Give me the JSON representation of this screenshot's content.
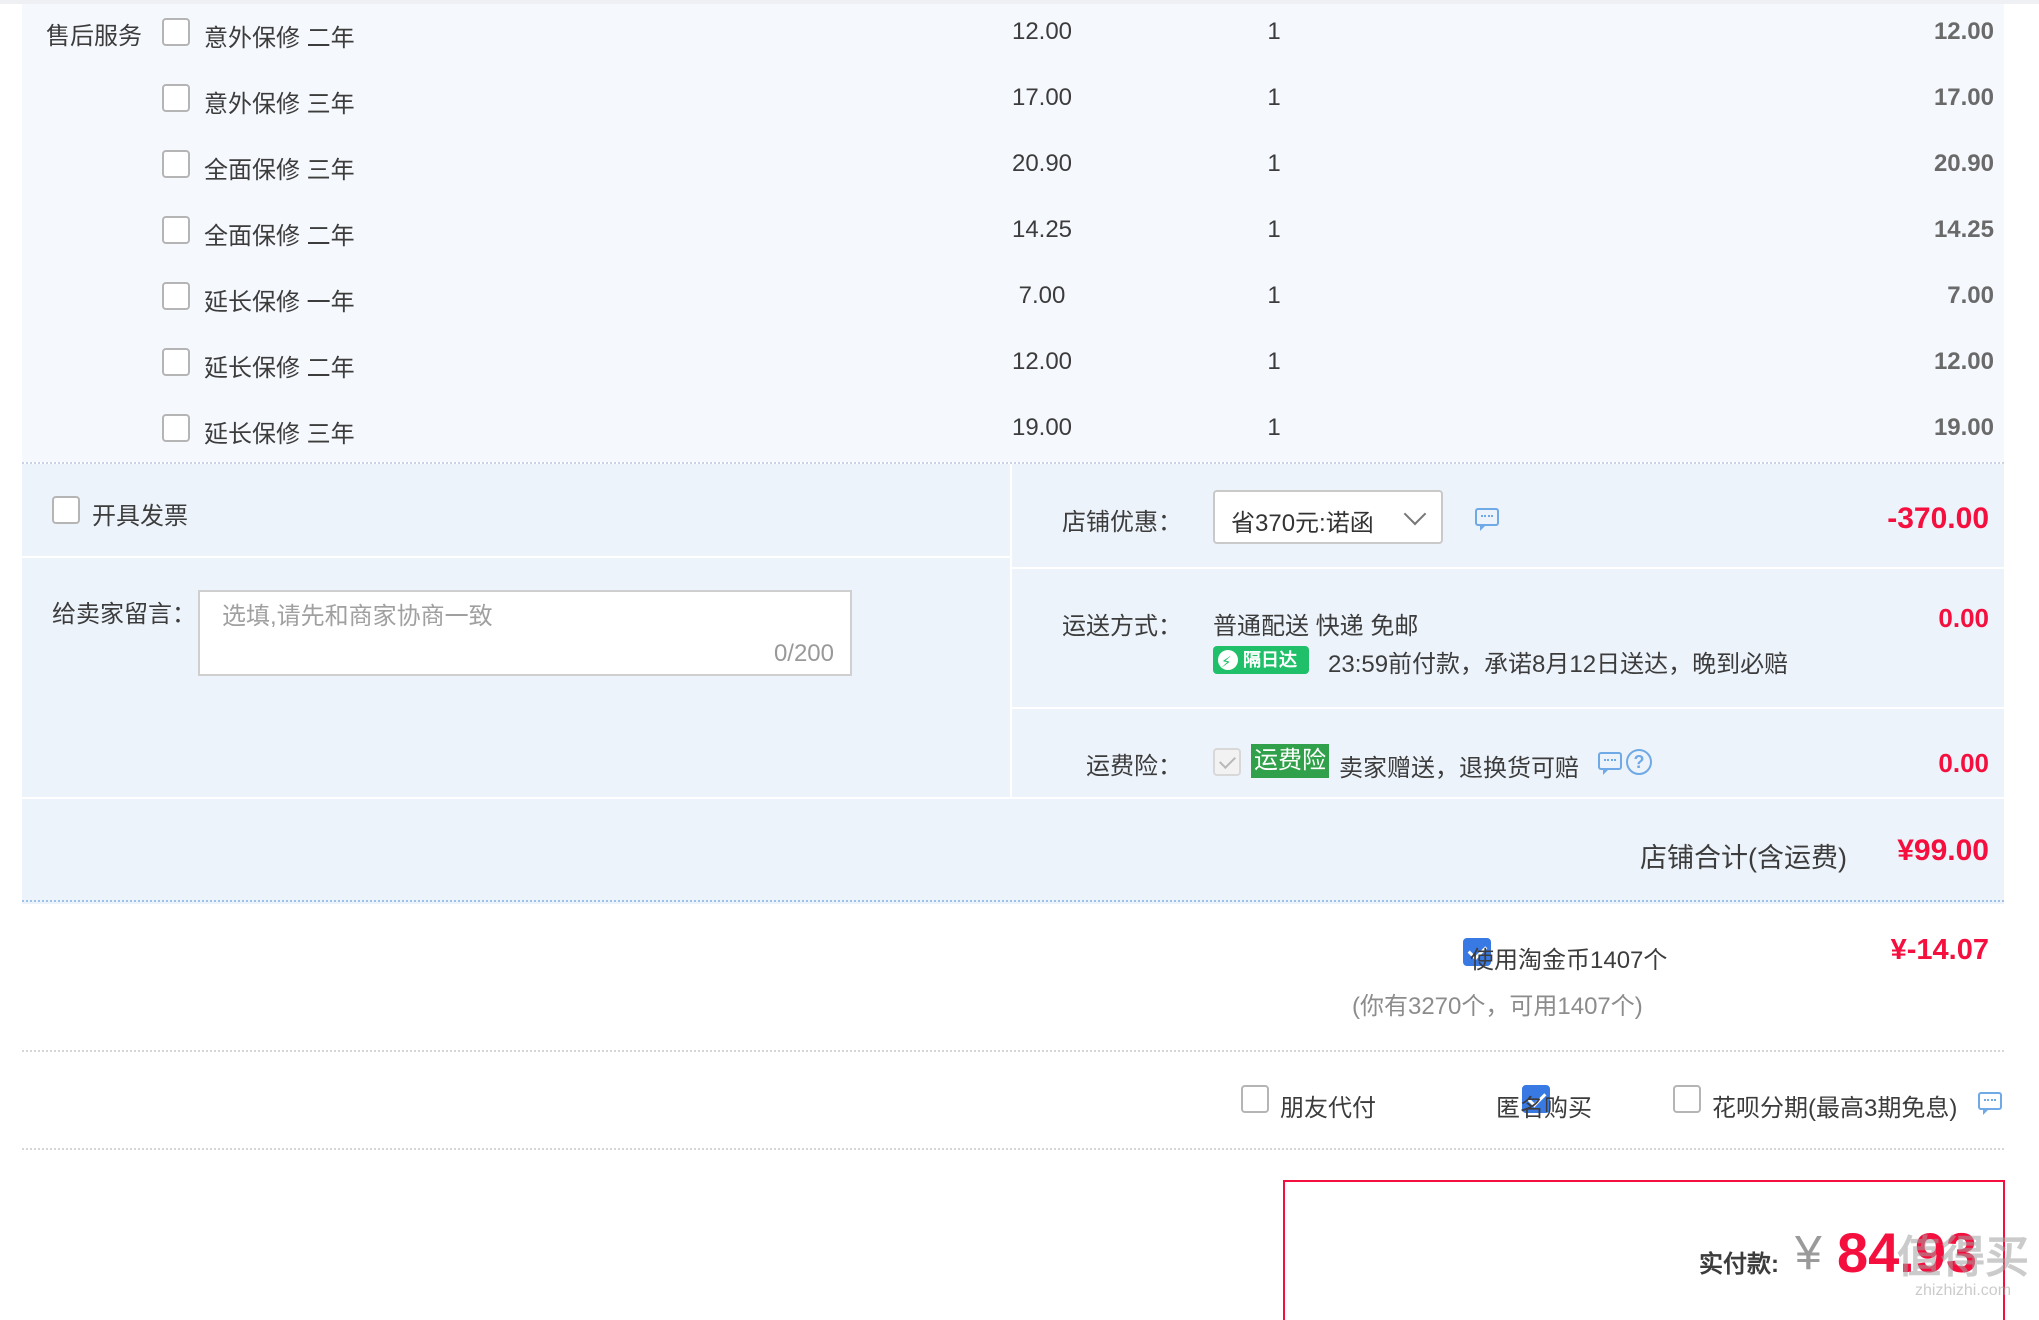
{
  "services": {
    "title": "售后服务",
    "items": [
      {
        "name": "意外保修 二年",
        "price": "12.00",
        "qty": "1",
        "total": "12.00"
      },
      {
        "name": "意外保修 三年",
        "price": "17.00",
        "qty": "1",
        "total": "17.00"
      },
      {
        "name": "全面保修 三年",
        "price": "20.90",
        "qty": "1",
        "total": "20.90"
      },
      {
        "name": "全面保修 二年",
        "price": "14.25",
        "qty": "1",
        "total": "14.25"
      },
      {
        "name": "延长保修 一年",
        "price": "7.00",
        "qty": "1",
        "total": "7.00"
      },
      {
        "name": "延长保修 二年",
        "price": "12.00",
        "qty": "1",
        "total": "12.00"
      },
      {
        "name": "延长保修 三年",
        "price": "19.00",
        "qty": "1",
        "total": "19.00"
      }
    ]
  },
  "invoice": {
    "label": "开具发票"
  },
  "message": {
    "label": "给卖家留言：",
    "placeholder": "选填,请先和商家协商一致",
    "count": "0/200"
  },
  "shop_discount": {
    "label": "店铺优惠：",
    "selected": "省370元:诺函",
    "amount": "-370.00"
  },
  "shipping": {
    "label": "运送方式：",
    "method": "普通配送 快递 免邮",
    "badge": "隔日达",
    "promise": "23:59前付款，承诺8月12日送达，晚到必赔",
    "amount": "0.00"
  },
  "freight_insurance": {
    "label": "运费险：",
    "tag": "运费险",
    "desc": "卖家赠送，退换货可赔",
    "amount": "0.00"
  },
  "shop_total": {
    "label": "店铺合计(含运费)",
    "amount": "¥99.00"
  },
  "coins": {
    "label": "使用淘金币1407个",
    "note": "(你有3270个，可用1407个)",
    "amount": "¥-14.07"
  },
  "options": {
    "friend_pay": "朋友代付",
    "anonymous": "匿名购买",
    "huabei": "花呗分期(最高3期免息)"
  },
  "payment": {
    "label": "实付款:",
    "currency": "¥",
    "amount": "84.93"
  },
  "watermark": {
    "line1": "值得买",
    "line2": "zhizhizhi.com"
  },
  "colors": {
    "accent_red": "#f40f3e",
    "check_blue": "#3879e4",
    "badge_green": "#20c06a"
  }
}
